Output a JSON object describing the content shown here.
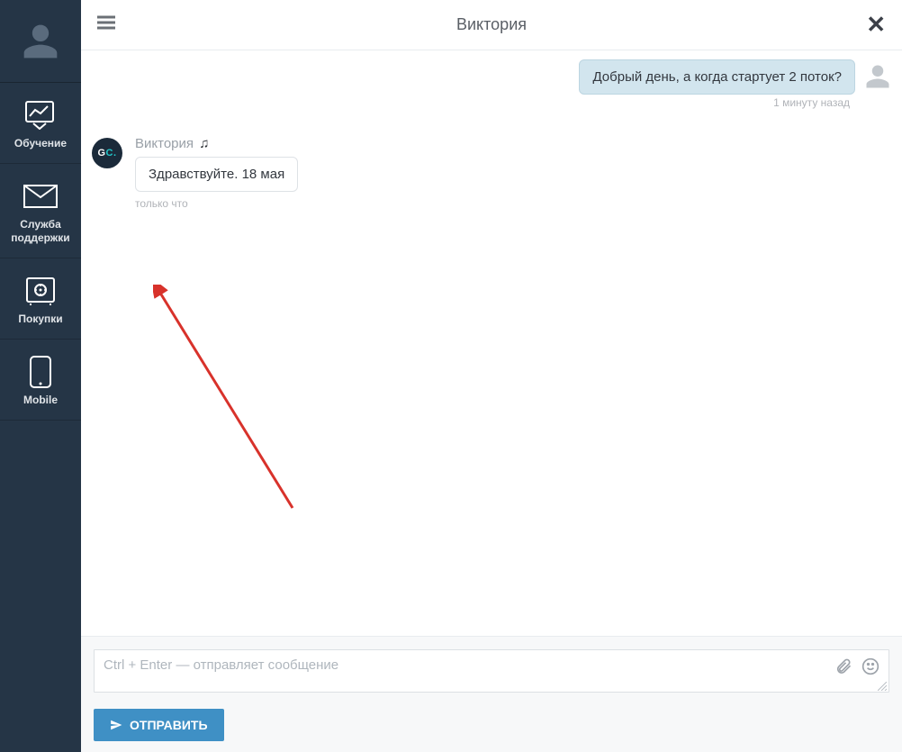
{
  "sidebar": {
    "items": [
      {
        "label": "Обучение",
        "icon": "chart-presentation-icon"
      },
      {
        "label": "Служба\nподдержки",
        "icon": "envelope-icon"
      },
      {
        "label": "Покупки",
        "icon": "safe-icon"
      },
      {
        "label": "Mobile",
        "icon": "phone-icon"
      }
    ]
  },
  "header": {
    "title": "Виктория"
  },
  "chat": {
    "my_message": {
      "text": "Добрый день, а когда стартует 2 поток?",
      "time": "1 минуту назад"
    },
    "reply": {
      "sender": "Виктория",
      "avatar_text_g": "G",
      "avatar_text_c": "C.",
      "text": "Здравствуйте. 18 мая",
      "time": "только что"
    }
  },
  "compose": {
    "placeholder": "Ctrl + Enter — отправляет сообщение",
    "send_label": "ОТПРАВИТЬ"
  }
}
